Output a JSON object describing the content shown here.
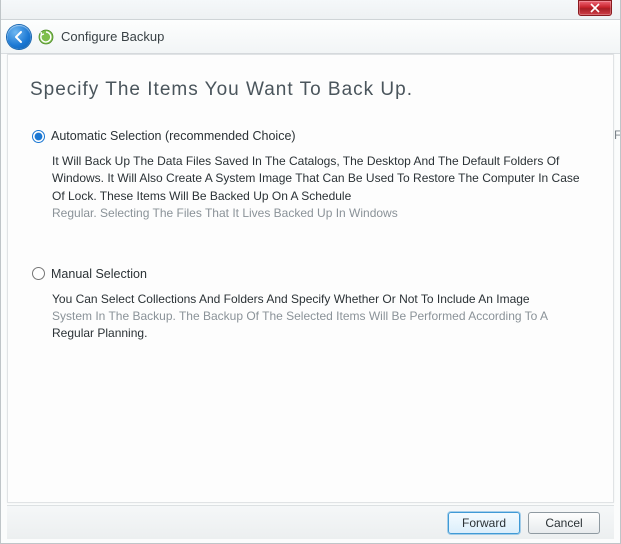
{
  "titlebar": {},
  "navbar": {
    "title": "Configure Backup"
  },
  "page": {
    "heading": "Specify The Items You Want To Back Up.",
    "options": {
      "auto": {
        "label": "Automatic Selection (recommended Choice)",
        "desc1": "It Will Back Up The Data Files Saved In The Catalogs, The Desktop And The Default Folders Of Windows. It Will Also Create A System Image That Can Be Used To Restore The Computer In Case Of Lock. These Items Will Be Backed Up On A Schedule",
        "desc2": "Regular. Selecting The Files That It Lives Backed Up In Windows"
      },
      "manual": {
        "label": "Manual Selection",
        "desc1": "You Can Select Collections And Folders And Specify Whether Or Not To Include An Image",
        "desc2": "System In The Backup. The Backup Of The Selected Items Will Be Performed According To A",
        "desc3": "Regular Planning."
      }
    }
  },
  "footer": {
    "forward": "Forward",
    "cancel": "Cancel"
  }
}
